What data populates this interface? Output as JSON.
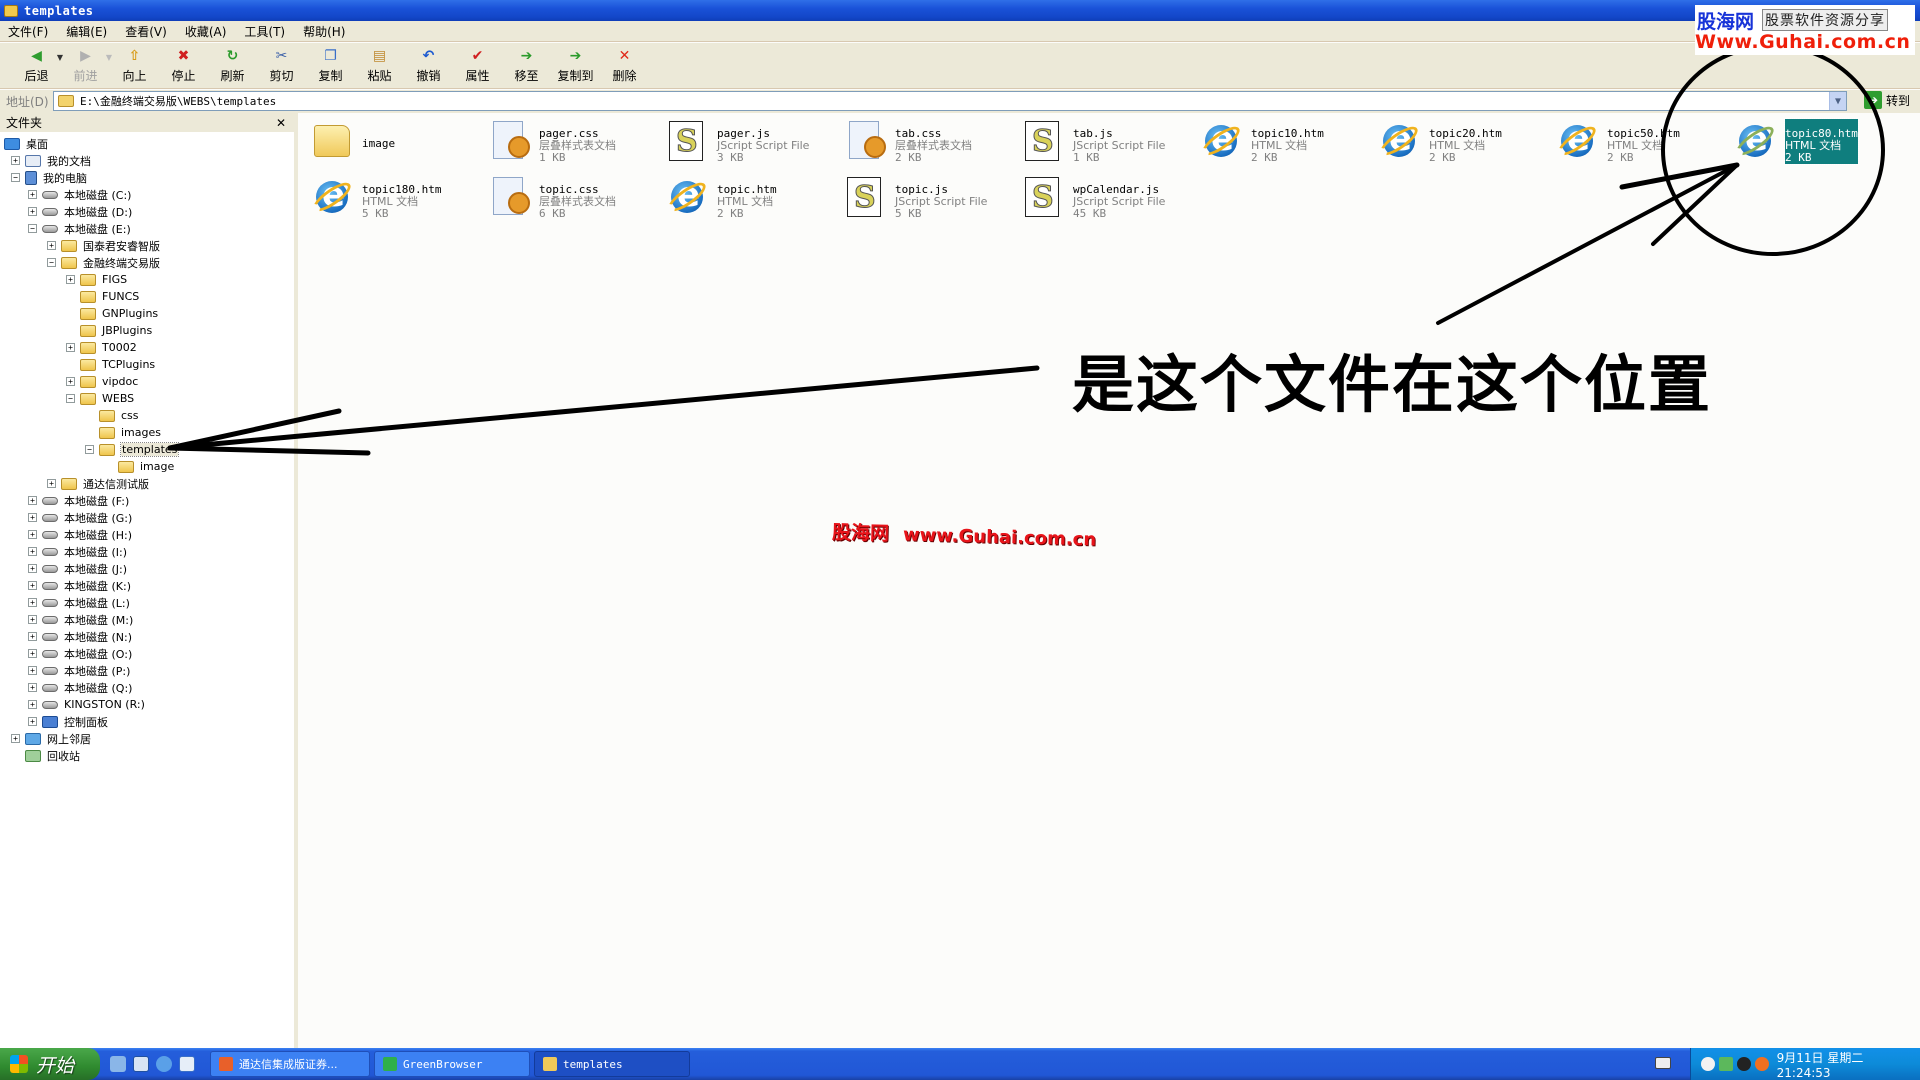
{
  "window": {
    "title": "templates"
  },
  "menubar": {
    "items": [
      "文件(F)",
      "编辑(E)",
      "查看(V)",
      "收藏(A)",
      "工具(T)",
      "帮助(H)"
    ]
  },
  "toolbar": {
    "buttons": [
      {
        "label": "后退",
        "icon": "back-arrow-icon",
        "enabled": true,
        "dropdown": true
      },
      {
        "label": "前进",
        "icon": "forward-arrow-icon",
        "enabled": false,
        "dropdown": true
      },
      {
        "label": "向上",
        "icon": "folder-up-icon",
        "enabled": true
      },
      {
        "label": "停止",
        "icon": "stop-icon",
        "enabled": true
      },
      {
        "label": "刷新",
        "icon": "refresh-icon",
        "enabled": true
      },
      {
        "label": "剪切",
        "icon": "scissors-icon",
        "enabled": true
      },
      {
        "label": "复制",
        "icon": "copy-icon",
        "enabled": true
      },
      {
        "label": "粘贴",
        "icon": "paste-icon",
        "enabled": true
      },
      {
        "label": "撤销",
        "icon": "undo-icon",
        "enabled": true
      },
      {
        "label": "属性",
        "icon": "properties-icon",
        "enabled": true
      },
      {
        "label": "移至",
        "icon": "move-to-icon",
        "enabled": true
      },
      {
        "label": "复制到",
        "icon": "copy-to-icon",
        "enabled": true
      },
      {
        "label": "删除",
        "icon": "delete-icon",
        "enabled": true
      }
    ]
  },
  "address": {
    "label": "地址(D)",
    "value": "E:\\金融终端交易版\\WEBS\\templates",
    "go_label": "转到"
  },
  "folder_pane": {
    "title": "文件夹",
    "close": "✕",
    "tree": [
      {
        "label": "桌面",
        "depth": 0,
        "exp": "none",
        "icon": "desktop"
      },
      {
        "label": "我的文档",
        "depth": 1,
        "exp": "plus",
        "icon": "docs"
      },
      {
        "label": "我的电脑",
        "depth": 1,
        "exp": "minus",
        "icon": "computer"
      },
      {
        "label": "本地磁盘 (C:)",
        "depth": 2,
        "exp": "plus",
        "icon": "drive"
      },
      {
        "label": "本地磁盘 (D:)",
        "depth": 2,
        "exp": "plus",
        "icon": "drive"
      },
      {
        "label": "本地磁盘 (E:)",
        "depth": 2,
        "exp": "minus",
        "icon": "drive"
      },
      {
        "label": "国泰君安睿智版",
        "depth": 3,
        "exp": "plus",
        "icon": "folder"
      },
      {
        "label": "金融终端交易版",
        "depth": 3,
        "exp": "minus",
        "icon": "folder"
      },
      {
        "label": "FIGS",
        "depth": 4,
        "exp": "plus",
        "icon": "folder"
      },
      {
        "label": "FUNCS",
        "depth": 4,
        "exp": "none",
        "icon": "folder"
      },
      {
        "label": "GNPlugins",
        "depth": 4,
        "exp": "none",
        "icon": "folder"
      },
      {
        "label": "JBPlugins",
        "depth": 4,
        "exp": "none",
        "icon": "folder"
      },
      {
        "label": "T0002",
        "depth": 4,
        "exp": "plus",
        "icon": "folder"
      },
      {
        "label": "TCPlugins",
        "depth": 4,
        "exp": "none",
        "icon": "folder"
      },
      {
        "label": "vipdoc",
        "depth": 4,
        "exp": "plus",
        "icon": "folder"
      },
      {
        "label": "WEBS",
        "depth": 4,
        "exp": "minus",
        "icon": "folder"
      },
      {
        "label": "css",
        "depth": 5,
        "exp": "none",
        "icon": "folder"
      },
      {
        "label": "images",
        "depth": 5,
        "exp": "none",
        "icon": "folder"
      },
      {
        "label": "templates",
        "depth": 5,
        "exp": "minus",
        "icon": "folder",
        "selected": true
      },
      {
        "label": "image",
        "depth": 6,
        "exp": "none",
        "icon": "folder"
      },
      {
        "label": "通达信测试版",
        "depth": 3,
        "exp": "plus",
        "icon": "folder"
      },
      {
        "label": "本地磁盘 (F:)",
        "depth": 2,
        "exp": "plus",
        "icon": "drive"
      },
      {
        "label": "本地磁盘 (G:)",
        "depth": 2,
        "exp": "plus",
        "icon": "drive"
      },
      {
        "label": "本地磁盘 (H:)",
        "depth": 2,
        "exp": "plus",
        "icon": "drive"
      },
      {
        "label": "本地磁盘 (I:)",
        "depth": 2,
        "exp": "plus",
        "icon": "drive"
      },
      {
        "label": "本地磁盘 (J:)",
        "depth": 2,
        "exp": "plus",
        "icon": "drive"
      },
      {
        "label": "本地磁盘 (K:)",
        "depth": 2,
        "exp": "plus",
        "icon": "drive"
      },
      {
        "label": "本地磁盘 (L:)",
        "depth": 2,
        "exp": "plus",
        "icon": "drive"
      },
      {
        "label": "本地磁盘 (M:)",
        "depth": 2,
        "exp": "plus",
        "icon": "drive"
      },
      {
        "label": "本地磁盘 (N:)",
        "depth": 2,
        "exp": "plus",
        "icon": "drive"
      },
      {
        "label": "本地磁盘 (O:)",
        "depth": 2,
        "exp": "plus",
        "icon": "drive"
      },
      {
        "label": "本地磁盘 (P:)",
        "depth": 2,
        "exp": "plus",
        "icon": "drive"
      },
      {
        "label": "本地磁盘 (Q:)",
        "depth": 2,
        "exp": "plus",
        "icon": "drive"
      },
      {
        "label": "KINGSTON (R:)",
        "depth": 2,
        "exp": "plus",
        "icon": "drive"
      },
      {
        "label": "控制面板",
        "depth": 2,
        "exp": "plus",
        "icon": "panel"
      },
      {
        "label": "网上邻居",
        "depth": 1,
        "exp": "plus",
        "icon": "network"
      },
      {
        "label": "回收站",
        "depth": 1,
        "exp": "none",
        "icon": "recycle"
      }
    ]
  },
  "files": [
    {
      "name": "image",
      "type": "",
      "size": "",
      "kind": "folder"
    },
    {
      "name": "pager.css",
      "type": "层叠样式表文档",
      "size": "1 KB",
      "kind": "css"
    },
    {
      "name": "pager.js",
      "type": "JScript Script File",
      "size": "3 KB",
      "kind": "js"
    },
    {
      "name": "tab.css",
      "type": "层叠样式表文档",
      "size": "2 KB",
      "kind": "css"
    },
    {
      "name": "tab.js",
      "type": "JScript Script File",
      "size": "1 KB",
      "kind": "js"
    },
    {
      "name": "topic10.htm",
      "type": "HTML 文档",
      "size": "2 KB",
      "kind": "htm"
    },
    {
      "name": "topic20.htm",
      "type": "HTML 文档",
      "size": "2 KB",
      "kind": "htm"
    },
    {
      "name": "topic50.htm",
      "type": "HTML 文档",
      "size": "2 KB",
      "kind": "htm"
    },
    {
      "name": "topic80.htm",
      "type": "HTML 文档",
      "size": "2 KB",
      "kind": "htm",
      "selected": true
    },
    {
      "name": "topic180.htm",
      "type": "HTML 文档",
      "size": "5 KB",
      "kind": "htm"
    },
    {
      "name": "topic.css",
      "type": "层叠样式表文档",
      "size": "6 KB",
      "kind": "css"
    },
    {
      "name": "topic.htm",
      "type": "HTML 文档",
      "size": "2 KB",
      "kind": "htm"
    },
    {
      "name": "topic.js",
      "type": "JScript Script File",
      "size": "5 KB",
      "kind": "js"
    },
    {
      "name": "wpCalendar.js",
      "type": "JScript Script File",
      "size": "45 KB",
      "kind": "js"
    }
  ],
  "annotations": {
    "note": "是这个文件在这个位置",
    "watermark_center_brand": "股海网",
    "watermark_center_url": "www.Guhai.com.cn",
    "watermark_corner_brand": "股海网",
    "watermark_corner_tag": "股票软件资源分享",
    "watermark_corner_url": "Www.Guhai.com.cn"
  },
  "taskbar": {
    "start_label": "开始",
    "tasks": [
      {
        "label": "通达信集成版证券...",
        "icon": "tdx-app-icon",
        "active": false
      },
      {
        "label": "GreenBrowser",
        "icon": "greenbrowser-icon",
        "active": false
      },
      {
        "label": "templates",
        "icon": "folder-icon",
        "active": true
      }
    ],
    "clock": "9月11日 星期二 21:24:53"
  },
  "colors": {
    "selection": "#0f7e7e",
    "title_bar": "#1a52d8",
    "chrome": "#ece9d8",
    "watermark_red": "#e8141a",
    "watermark_blue": "#1733d8"
  }
}
